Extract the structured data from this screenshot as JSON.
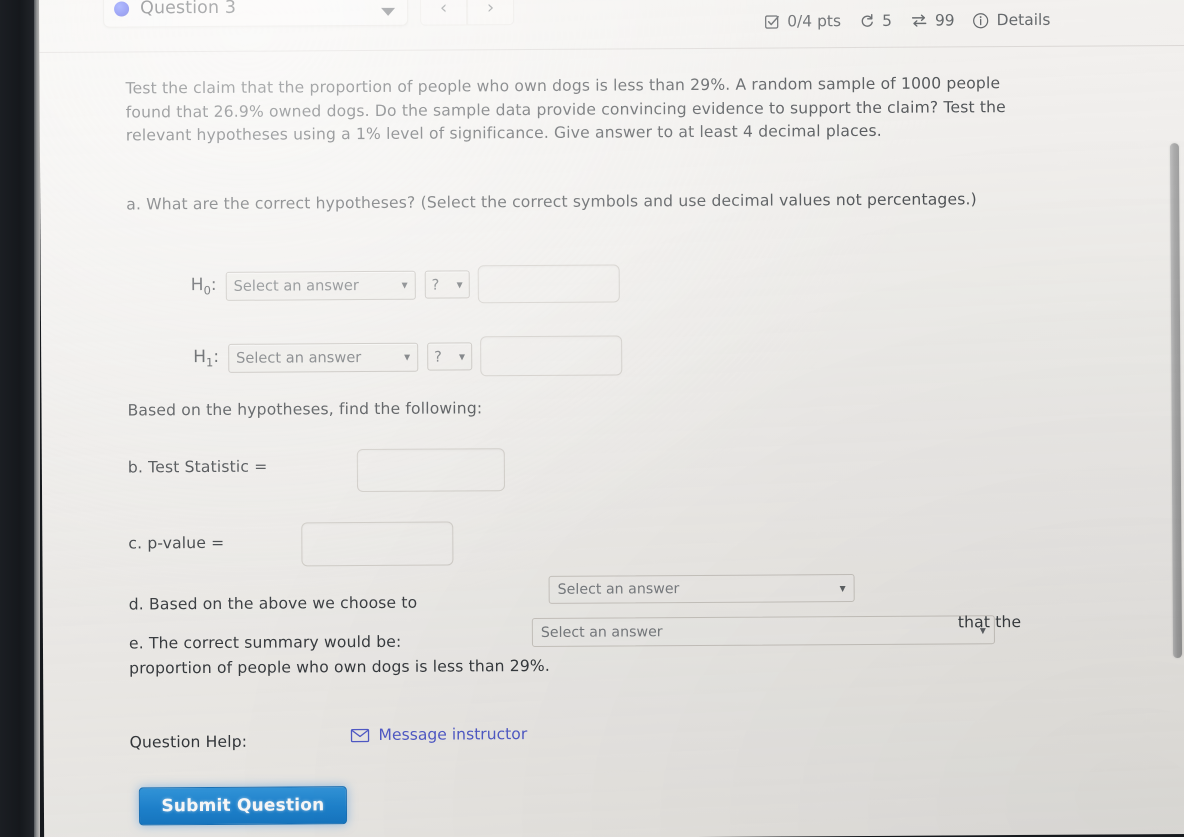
{
  "header": {
    "question_title": "Question 3",
    "status_dot_icon": "blue-dot-icon",
    "caret_icon": "caret-down-icon",
    "nav_prev_icon": "‹",
    "nav_next_icon": "›",
    "points": "0/4 pts",
    "attempts": "5",
    "version": "99",
    "details_label": "Details",
    "check_icon": "checkbox-check-icon",
    "retry_icon": "retry-arrow-icon",
    "swap_icon": "swap-arrows-icon",
    "info_icon": "info-circle-icon"
  },
  "prompt": "Test the claim that the proportion of people who own dogs is less than 29%. A random sample of 1000 people found that 26.9% owned dogs. Do the sample data provide convincing evidence to support the claim? Test the relevant hypotheses using a 1% level of significance. Give answer to at least 4 decimal places.",
  "parts": {
    "a_text": "a. What are the correct hypotheses? (Select the correct symbols and use decimal values not percentages.)",
    "h0_label": "H",
    "h0_sub": "0",
    "h0_colon": ":",
    "h1_label": "H",
    "h1_sub": "1",
    "h1_colon": ":",
    "select_answer_placeholder": "Select an answer",
    "qmark_placeholder": "?",
    "h0_value": "",
    "h1_value": "",
    "based_on_text": "Based on the hypotheses, find the following:",
    "b_label": "b. Test Statistic =",
    "b_value": "",
    "c_label": "c. p-value =",
    "c_value": "",
    "d_label": "d. Based on the above we choose to",
    "d_select_value": "Select an answer",
    "e_label": "e. The correct summary would be:",
    "e_select_value": "Select an answer",
    "e_that_the": "that the",
    "e_tail": "proportion of people who own dogs is less than 29%."
  },
  "footer": {
    "question_help_label": "Question Help:",
    "message_instructor_label": "Message instructor",
    "envelope_icon": "envelope-icon",
    "submit_label": "Submit Question"
  },
  "colors": {
    "link": "#4b55c8",
    "submit_bg": "#1a82d0",
    "dot": "#2030e8"
  }
}
